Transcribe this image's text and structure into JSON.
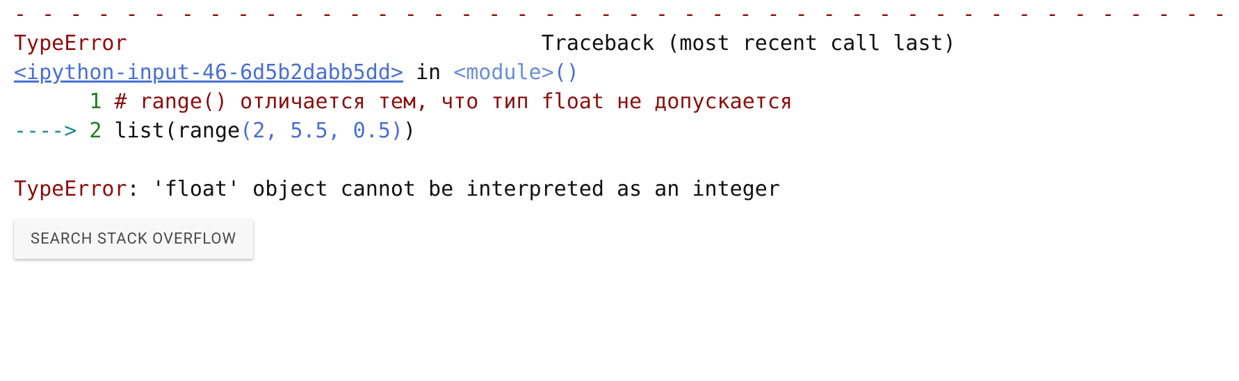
{
  "traceback": {
    "dashes": "- - - - - - - - - - - - - - - - - - - - - - - - - - - - - - - - - - - - - - - - - - - - - - - - - - - - - - - - - - -",
    "error_name": "TypeError",
    "header_right": "Traceback (most recent call last)",
    "frame_link": "<ipython-input-46-6d5b2dabb5dd>",
    "in_word": " in ",
    "module_label": "<module>",
    "module_call_open": "(",
    "module_call_close": ")",
    "lines": [
      {
        "prefix": "      ",
        "lineno": "1",
        "comment": " # range() отличается тем, что тип float не допускается"
      },
      {
        "prefix": "----> ",
        "lineno": "2",
        "code_prefix": " list",
        "paren_open": "(",
        "fn_name": "range",
        "args_open": "(",
        "args": "2, 5.5, 0.5",
        "args_close": ")",
        "paren_close": ")"
      }
    ],
    "error_prefix": "TypeError",
    "error_sep": ": ",
    "error_msg": "'float' object cannot be interpreted as an integer"
  },
  "button": {
    "search_so_label": "SEARCH STACK OVERFLOW"
  }
}
